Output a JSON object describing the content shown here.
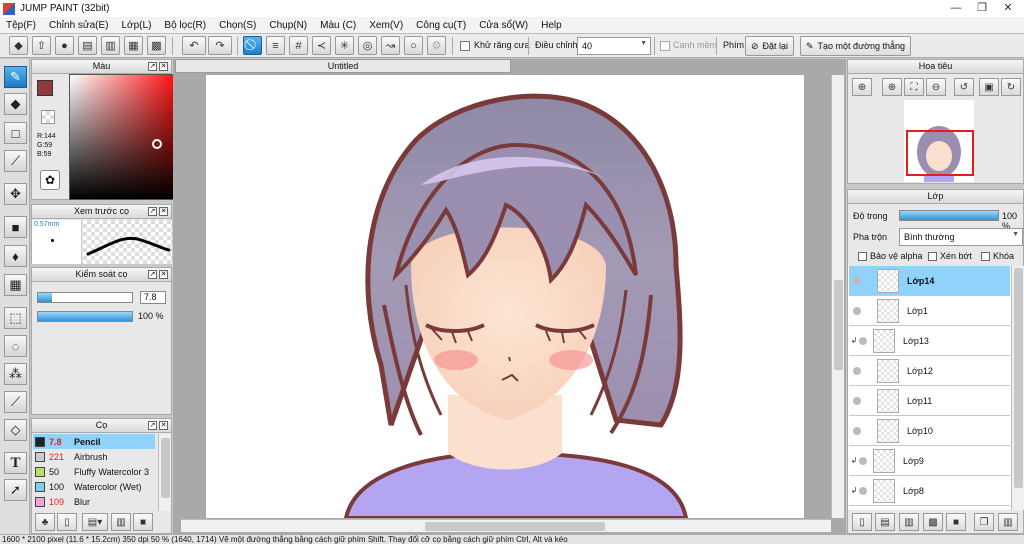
{
  "window": {
    "title": "JUMP PAINT (32bit)",
    "minimize": "—",
    "restore": "❐",
    "close": "✕"
  },
  "menu": [
    "Tệp(F)",
    "Chỉnh sửa(E)",
    "Lớp(L)",
    "Bộ lọc(R)",
    "Chọn(S)",
    "Chụp(N)",
    "Màu (C)",
    "Xem(V)",
    "Công cụ(T)",
    "Cửa sổ(W)",
    "Help"
  ],
  "toolbar": {
    "antialias_label": "Khử răng cưa",
    "adjust_label": "Điều chỉnh",
    "adjust_value": "40",
    "smooth_edge_label": "Cạnh mềm",
    "key_label": "Phím",
    "reset_label": "Đặt lại",
    "straight_line_label": "Tạo một đường thẳng"
  },
  "color_panel": {
    "title": "Màu",
    "rgb_r": "R:144",
    "rgb_g": "G:59",
    "rgb_b": "B:59",
    "main_color": "#903b3b"
  },
  "preview_panel": {
    "title": "Xem trước cọ",
    "size": "0.57mm"
  },
  "control_panel": {
    "title": "Kiểm soát cọ",
    "size_value": "7.8",
    "opacity_value": "100 %",
    "size_fraction": 0.3,
    "opacity_fraction": 1.0
  },
  "brush_panel": {
    "title": "Cọ",
    "brushes": [
      {
        "size": "7.8",
        "name": "Pencil",
        "color": "#222222",
        "size_color": "#e02020"
      },
      {
        "size": "221",
        "name": "Airbrush",
        "color": "#cccccc",
        "size_color": "#e02020"
      },
      {
        "size": "50",
        "name": "Fluffy Watercolor 3",
        "color": "#b7e06a",
        "size_color": "#111111"
      },
      {
        "size": "100",
        "name": "Watercolor (Wet)",
        "color": "#7fd3ef",
        "size_color": "#111111"
      },
      {
        "size": "109",
        "name": "Blur",
        "color": "#f2a4d8",
        "size_color": "#e02020"
      }
    ]
  },
  "canvas": {
    "tab_title": "Untitled"
  },
  "navigator": {
    "title": "Hoa tiêu"
  },
  "layer_panel": {
    "title": "Lớp",
    "opacity_label": "Độ trong",
    "opacity_value": "100 %",
    "opacity_fraction": 1.0,
    "blend_label": "Pha trộn",
    "blend_value": "Bình thường",
    "protect_alpha": "Bảo vệ alpha",
    "clip": "Xén bớt",
    "lock": "Khóa",
    "layers": [
      {
        "name": "Lớp14",
        "selected": true,
        "clip": false
      },
      {
        "name": "Lớp1",
        "selected": false,
        "clip": false
      },
      {
        "name": "Lớp13",
        "selected": false,
        "clip": true
      },
      {
        "name": "Lớp12",
        "selected": false,
        "clip": false
      },
      {
        "name": "Lớp11",
        "selected": false,
        "clip": false
      },
      {
        "name": "Lớp10",
        "selected": false,
        "clip": false
      },
      {
        "name": "Lớp9",
        "selected": false,
        "clip": true
      },
      {
        "name": "Lớp8",
        "selected": false,
        "clip": true
      }
    ]
  },
  "status": "1600 * 2100 pixel  (11.6 * 15.2cm)  350 dpi  50 %  (1640, 1714)  Vẽ một đường thẳng bằng cách giữ phím Shift. Thay đổi cỡ cọ bằng cách giữ phím Ctrl, Alt và kéo"
}
